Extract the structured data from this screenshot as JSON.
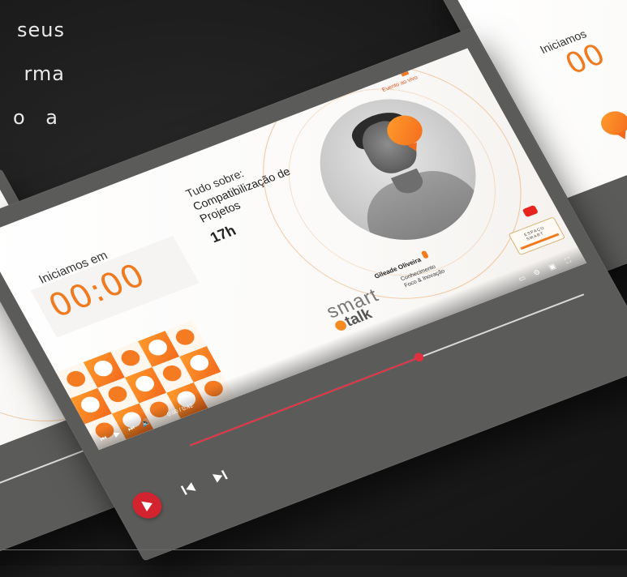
{
  "intro": {
    "lines": [
      "seus",
      "rma",
      "o  a"
    ]
  },
  "main_player": {
    "starts_label": "Iniciamos em",
    "timer": "00:00",
    "topic_label": "Tudo sobre:",
    "topic": "Compatibilização de Projetos",
    "time": "17h",
    "live_tag": "Evento ao vivo",
    "speaker_name": "Gileade Oliveira",
    "speaker_role": "",
    "brand_smart": "smart",
    "brand_talk": "talk",
    "brand_tagline": "Conhecimento Foco & Inovação",
    "partner": "ESPAÇO SMART",
    "mini_time": "0:00 / 0:42",
    "progress": 0.58
  },
  "right_player": {
    "starts_label": "Iniciamos",
    "timer": "00"
  },
  "colors": {
    "accent_orange": "#f07a1f",
    "progress_red": "#e03042",
    "device_gray": "#5b5b59",
    "background": "#1c1c1c"
  },
  "icons": {
    "play": "play-icon",
    "prev": "skip-previous-icon",
    "next": "skip-next-icon"
  }
}
